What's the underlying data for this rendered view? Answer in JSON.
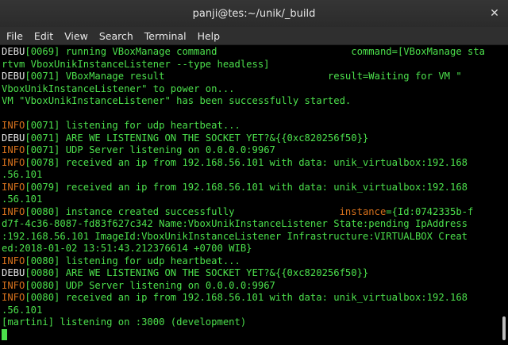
{
  "window": {
    "title": "panji@tes:~/unik/_build",
    "close_glyph": "✕"
  },
  "menu": [
    "File",
    "Edit",
    "View",
    "Search",
    "Terminal",
    "Help"
  ],
  "colors": {
    "green": "#4ce04c",
    "orange": "#d7711c",
    "white": "#e6e6e6",
    "background": "#000000"
  },
  "terminal": {
    "lines": [
      [
        [
          "w",
          "DEBU"
        ],
        [
          "g",
          "[0069] running VBoxManage command                       command=[VBoxManage sta"
        ]
      ],
      [
        [
          "g",
          "rtvm VboxUnikInstanceListener --type headless]"
        ]
      ],
      [
        [
          "w",
          "DEBU"
        ],
        [
          "g",
          "[0071] VBoxManage result                            result=Waiting for VM \""
        ]
      ],
      [
        [
          "g",
          "VboxUnikInstanceListener\" to power on..."
        ]
      ],
      [
        [
          "g",
          "VM \"VboxUnikInstanceListener\" has been successfully started."
        ]
      ],
      [
        [
          "g",
          " "
        ]
      ],
      [
        [
          "o",
          "INFO"
        ],
        [
          "g",
          "[0071] listening for udp heartbeat..."
        ]
      ],
      [
        [
          "w",
          "DEBU"
        ],
        [
          "g",
          "[0071] ARE WE LISTENING ON THE SOCKET YET?&{{0xc820256f50}}"
        ]
      ],
      [
        [
          "o",
          "INFO"
        ],
        [
          "g",
          "[0071] UDP Server listening on 0.0.0.0:9967"
        ]
      ],
      [
        [
          "o",
          "INFO"
        ],
        [
          "g",
          "[0078] received an ip from 192.168.56.101 with data: unik_virtualbox:192.168"
        ]
      ],
      [
        [
          "g",
          ".56.101"
        ]
      ],
      [
        [
          "o",
          "INFO"
        ],
        [
          "g",
          "[0079] received an ip from 192.168.56.101 with data: unik_virtualbox:192.168"
        ]
      ],
      [
        [
          "g",
          ".56.101"
        ]
      ],
      [
        [
          "o",
          "INFO"
        ],
        [
          "g",
          "[0080] instance created successfully                  "
        ],
        [
          "o",
          "instance"
        ],
        [
          "g",
          "={Id:0742335b-f"
        ]
      ],
      [
        [
          "g",
          "d7f-4c36-8087-fd83f627c342 Name:VboxUnikInstanceListener State:pending IpAddress"
        ]
      ],
      [
        [
          "g",
          ":192.168.56.101 ImageId:VboxUnikInstanceListener Infrastructure:VIRTUALBOX Creat"
        ]
      ],
      [
        [
          "g",
          "ed:2018-01-02 13:51:43.212376614 +0700 WIB}"
        ]
      ],
      [
        [
          "o",
          "INFO"
        ],
        [
          "g",
          "[0080] listening for udp heartbeat..."
        ]
      ],
      [
        [
          "w",
          "DEBU"
        ],
        [
          "g",
          "[0080] ARE WE LISTENING ON THE SOCKET YET?&{{0xc820256f50}}"
        ]
      ],
      [
        [
          "o",
          "INFO"
        ],
        [
          "g",
          "[0080] UDP Server listening on 0.0.0.0:9967"
        ]
      ],
      [
        [
          "o",
          "INFO"
        ],
        [
          "g",
          "[0080] received an ip from 192.168.56.101 with data: unik_virtualbox:192.168"
        ]
      ],
      [
        [
          "g",
          ".56.101"
        ]
      ],
      [
        [
          "g",
          "[martini] listening on :3000 (development)"
        ]
      ]
    ]
  }
}
